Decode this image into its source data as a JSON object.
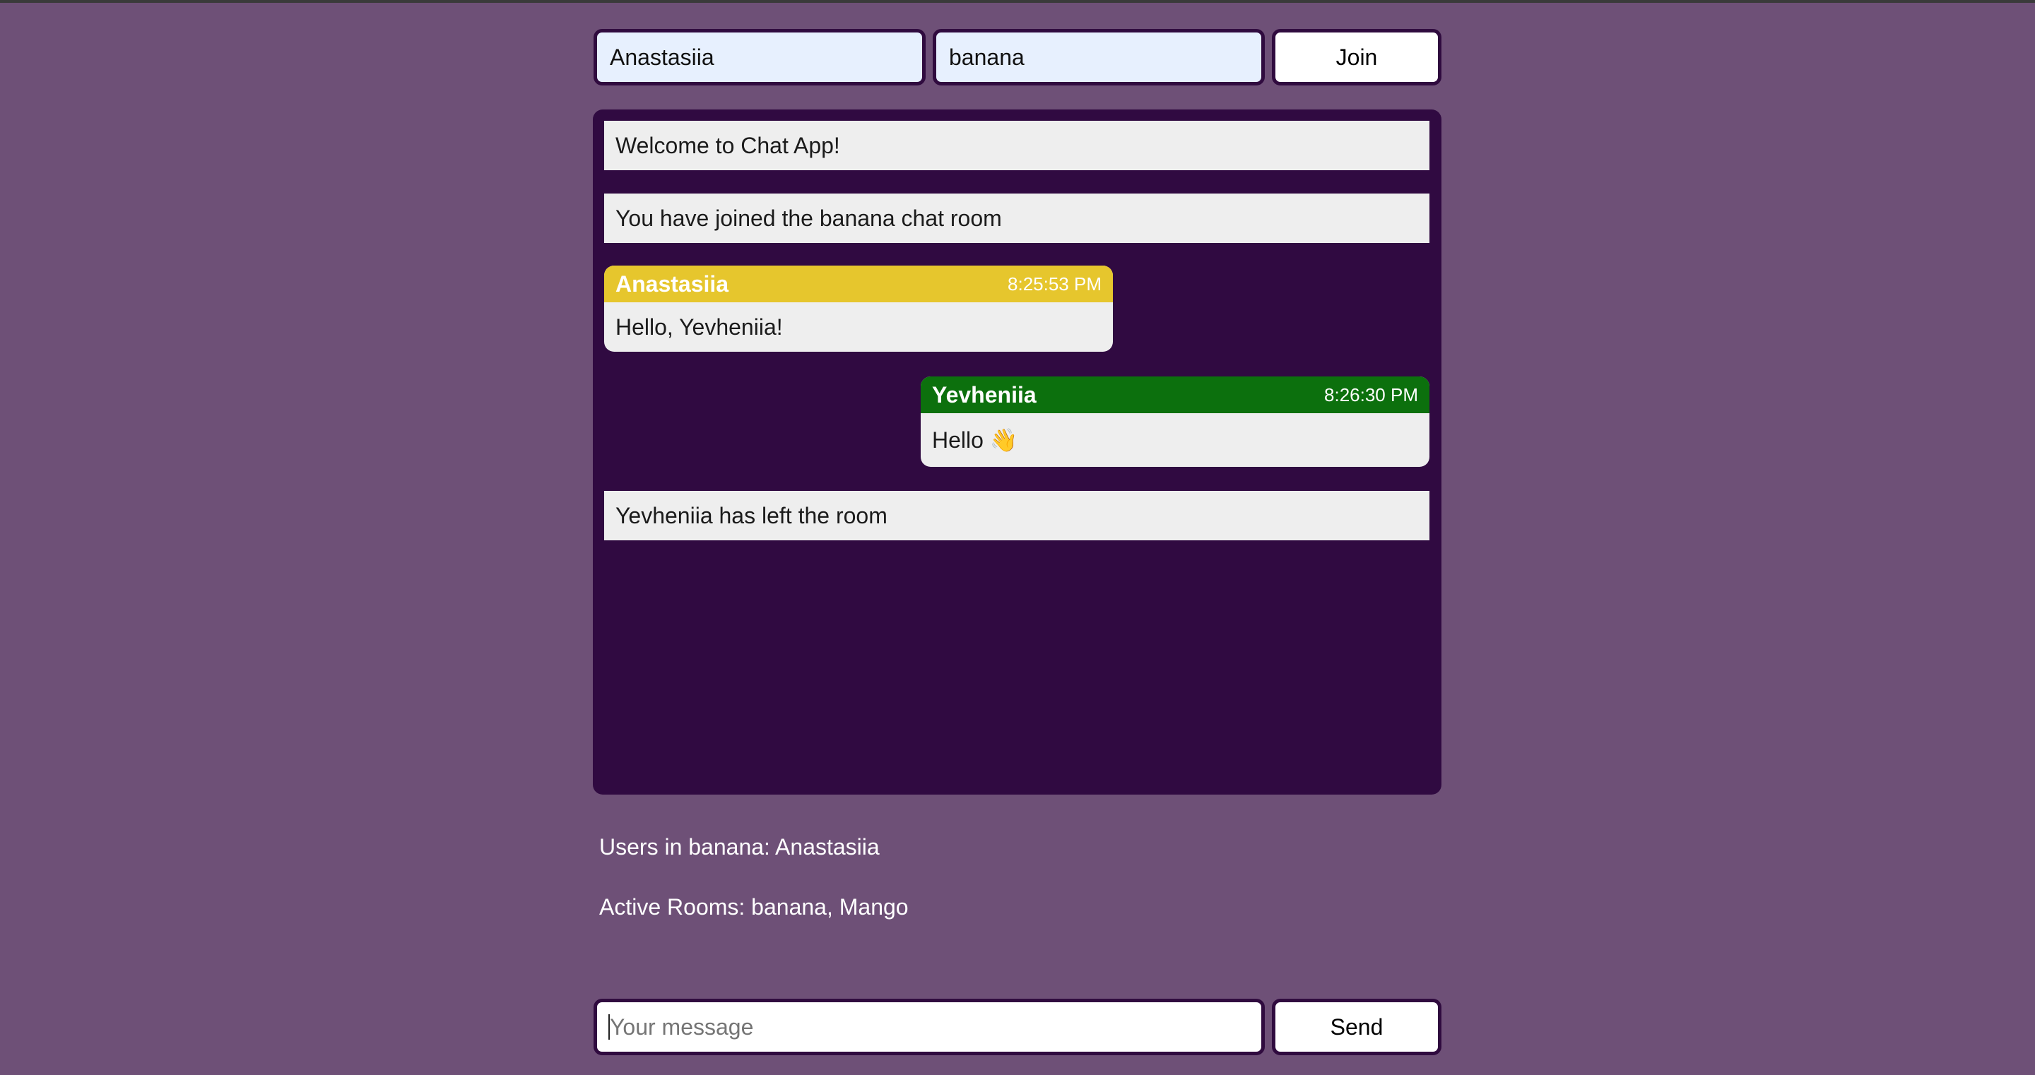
{
  "join_form": {
    "name_value": "Anastasiia",
    "room_value": "banana",
    "join_label": "Join"
  },
  "chat": {
    "notices": [
      "Welcome to Chat App!",
      "You have joined the banana chat room",
      "Yevheniia has left the room"
    ],
    "messages": [
      {
        "author": "Anastasiia",
        "time": "8:25:53 PM",
        "text": "Hello, Yevheniia!",
        "color": "#e6c62d",
        "align": "left"
      },
      {
        "author": "Yevheniia",
        "time": "8:26:30 PM",
        "text": "Hello 👋",
        "color": "#0c700d",
        "align": "right"
      }
    ]
  },
  "info": {
    "users": "Users in banana: Anastasiia",
    "rooms": "Active Rooms: banana, Mango"
  },
  "composer": {
    "placeholder": "Your message",
    "send_label": "Send"
  },
  "colors": {
    "page_background": "#6e5077",
    "panel_background": "#300a41",
    "border": "#300b3f"
  }
}
